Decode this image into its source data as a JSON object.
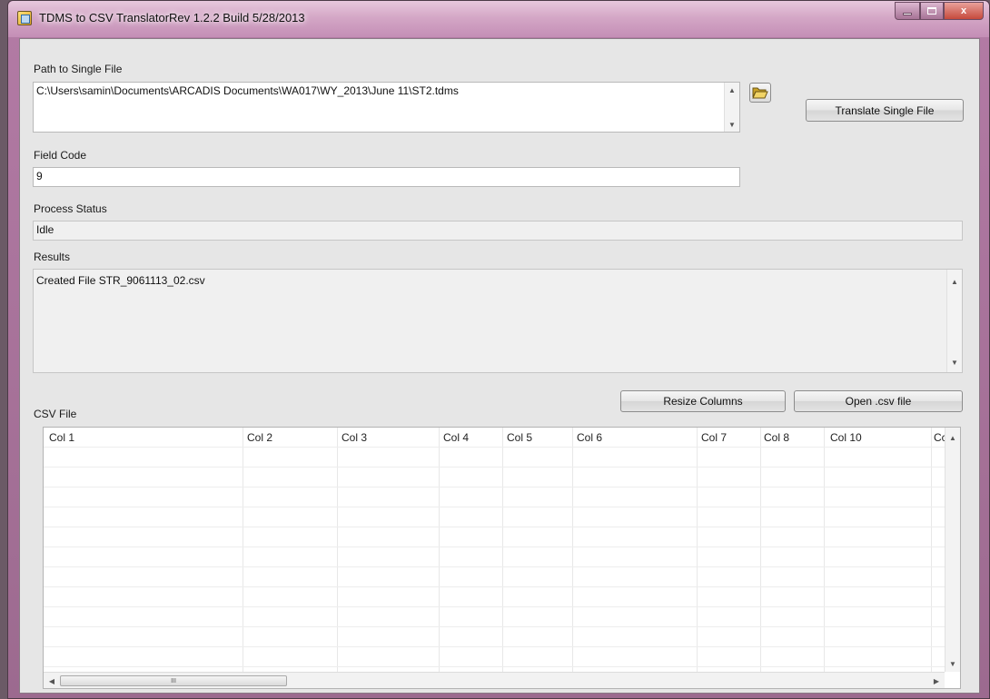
{
  "window": {
    "title": "TDMS to CSV TranslatorRev 1.2.2 Build 5/28/2013",
    "close_glyph": "x"
  },
  "path": {
    "label": "Path to Single File",
    "value": "C:\\Users\\samin\\Documents\\ARCADIS Documents\\WA017\\WY_2013\\June 11\\ST2.tdms"
  },
  "buttons": {
    "translate_single": "Translate Single File",
    "resize_columns": "Resize Columns",
    "open_csv": "Open .csv file"
  },
  "field_code": {
    "label": "Field Code",
    "value": "9"
  },
  "process_status": {
    "label": "Process Status",
    "value": "Idle"
  },
  "results": {
    "label": "Results",
    "value": "Created File STR_9061113_02.csv"
  },
  "csv": {
    "label": "CSV File",
    "columns": [
      "Col 1",
      "Col 2",
      "Col 3",
      "Col 4",
      "Col 5",
      "Col 6",
      "Col 7",
      "Col 8",
      "Col 10",
      "Cc"
    ]
  },
  "scrollbar_glyph": "III",
  "icons": [
    "app-icon",
    "folder-open-icon",
    "minimize-icon",
    "maximize-icon",
    "close-icon"
  ]
}
